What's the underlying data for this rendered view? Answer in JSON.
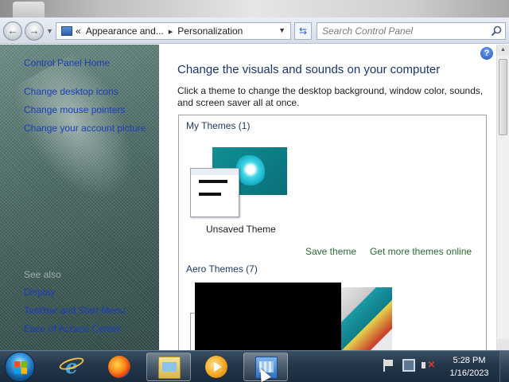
{
  "address_bar": {
    "breadcrumb_prefix": "«",
    "breadcrumb_items": [
      "Appearance and...",
      "Personalization"
    ],
    "breadcrumb_separator": "▸",
    "search_placeholder": "Search Control Panel"
  },
  "sidebar": {
    "home_link": "Control Panel Home",
    "links": [
      "Change desktop icons",
      "Change mouse pointers",
      "Change your account picture"
    ],
    "see_also_heading": "See also",
    "see_also_links": [
      "Display",
      "Taskbar and Start Menu",
      "Ease of Access Center"
    ]
  },
  "main": {
    "title": "Change the visuals and sounds on your computer",
    "description": "Click a theme to change the desktop background, window color, sounds, and screen saver all at once.",
    "my_themes_heading": "My Themes (1)",
    "unsaved_theme_name": "Unsaved Theme",
    "save_theme_link": "Save theme",
    "get_more_themes_link": "Get more themes online",
    "aero_themes_heading": "Aero Themes (7)",
    "help_label": "?"
  },
  "taskbar": {
    "pinned": [
      "Internet Explorer",
      "Firefox",
      "Windows Explorer",
      "Windows Media Player",
      "Personalization"
    ],
    "clock_time": "5:28 PM",
    "clock_date": "1/16/2023"
  },
  "colors": {
    "link": "#1a3fb8",
    "action_link": "#2a6b33",
    "title": "#1b3668",
    "taskbar": "#23364a"
  }
}
